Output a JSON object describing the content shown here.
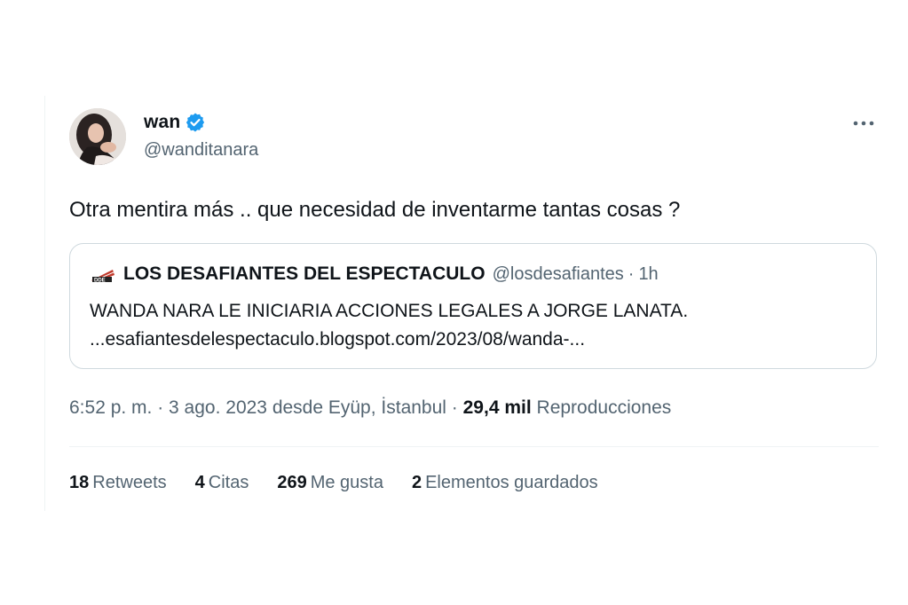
{
  "author": {
    "name": "wan",
    "handle": "@wanditanara",
    "verified_color": "#1d9bf0"
  },
  "tweet": {
    "text": "Otra mentira más .. que necesidad de inventarme tantas cosas ?"
  },
  "quote": {
    "name": "LOS DESAFIANTES DEL ESPECTACULO",
    "handle": "@losdesafiantes",
    "separator": "·",
    "time": "1h",
    "line1": "WANDA NARA LE INICIARIA ACCIONES LEGALES A JORGE LANATA.",
    "line2": "...esafiantesdelespectaculo.blogspot.com/2023/08/wanda-..."
  },
  "meta": {
    "timestamp": "6:52 p. m. · 3 ago. 2023 desde Eyüp, İstanbul · ",
    "views_count": "29,4 mil",
    "views_label": " Reproducciones"
  },
  "stats": [
    {
      "count": "18",
      "label": "Retweets"
    },
    {
      "count": "4",
      "label": "Citas"
    },
    {
      "count": "269",
      "label": "Me gusta"
    },
    {
      "count": "2",
      "label": "Elementos guardados"
    }
  ],
  "icons": {
    "more": "more-horizontal-icon",
    "verified": "verified-badge-icon"
  }
}
